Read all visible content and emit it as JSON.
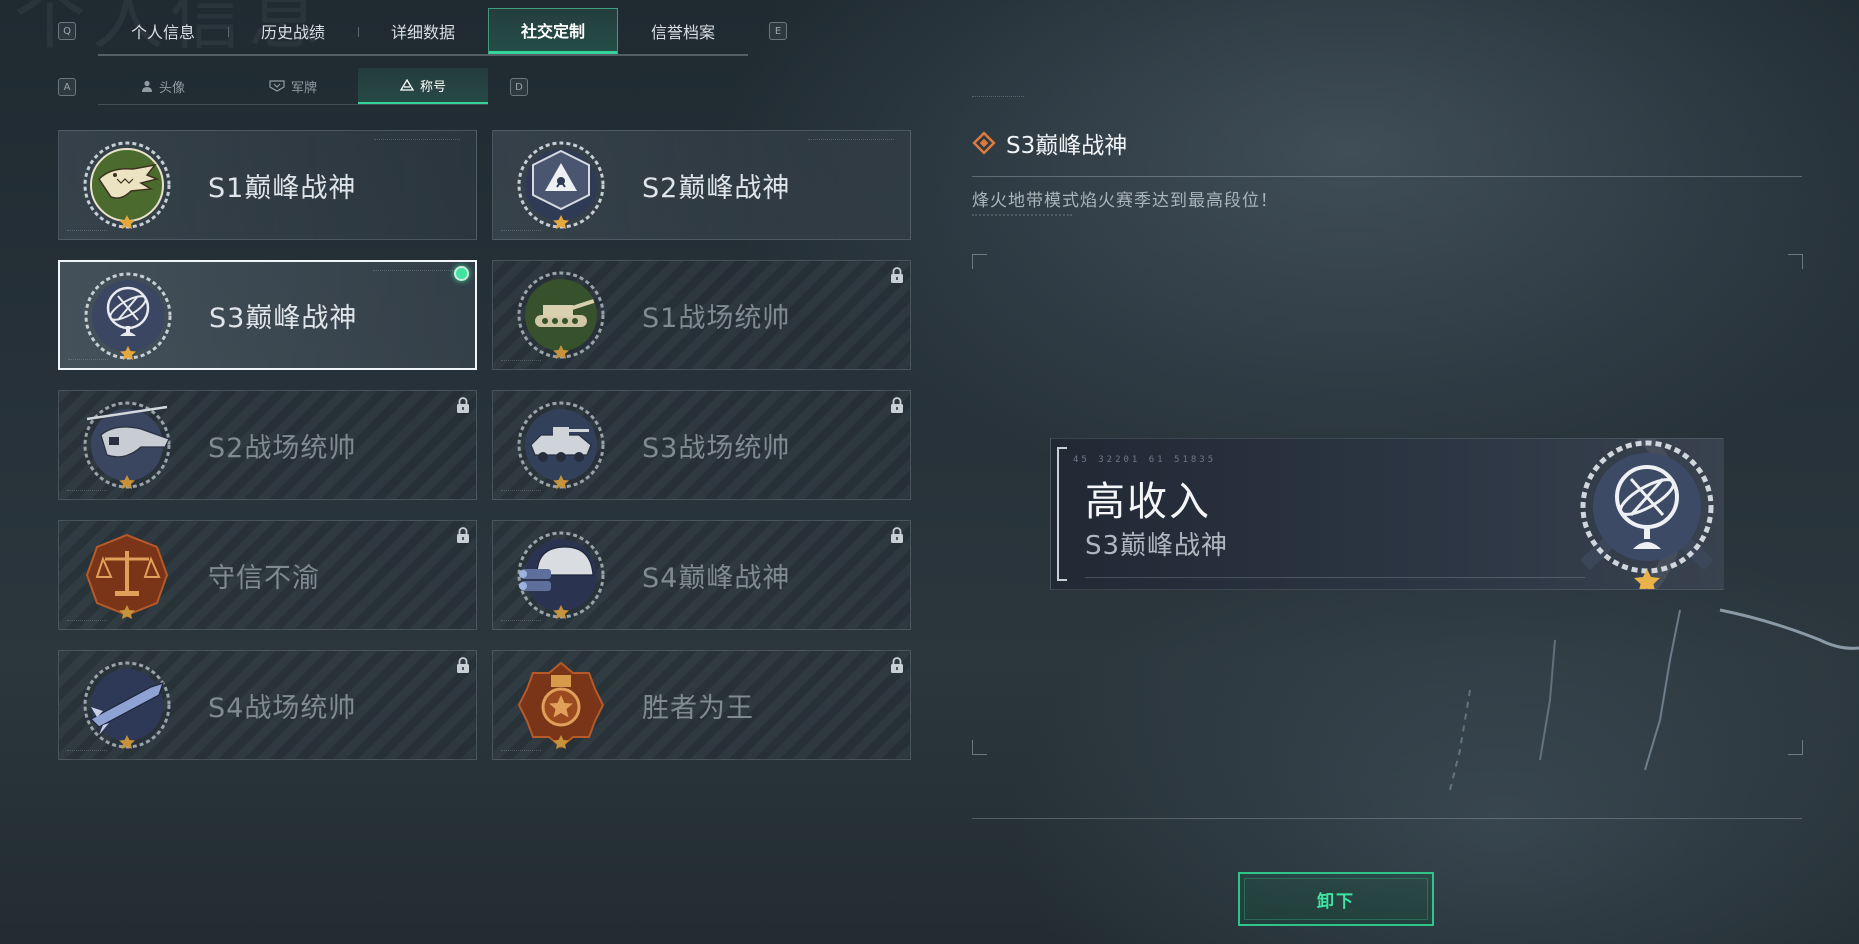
{
  "top_nav": {
    "prev_key": "Q",
    "next_key": "E",
    "tabs": [
      {
        "label": "个人信息"
      },
      {
        "label": "历史战绩"
      },
      {
        "label": "详细数据"
      },
      {
        "label": "社交定制"
      },
      {
        "label": "信誉档案"
      }
    ],
    "active_index": 3
  },
  "sub_nav": {
    "prev_key": "A",
    "next_key": "D",
    "tabs": [
      {
        "label": "头像",
        "icon": "user-icon"
      },
      {
        "label": "军牌",
        "icon": "dog-tag-icon"
      },
      {
        "label": "称号",
        "icon": "title-icon"
      }
    ],
    "active_index": 2
  },
  "titles": [
    {
      "name": "S1巅峰战神",
      "emblem": "crocodile-emblem",
      "locked": false,
      "selected": false
    },
    {
      "name": "S2巅峰战神",
      "emblem": "hazard-triangle-emblem",
      "locked": false,
      "selected": false
    },
    {
      "name": "S3巅峰战神",
      "emblem": "armillary-sphere-emblem",
      "locked": false,
      "selected": true
    },
    {
      "name": "S1战场统帅",
      "emblem": "tank-emblem",
      "locked": true,
      "selected": false
    },
    {
      "name": "S2战场统帅",
      "emblem": "helicopter-emblem",
      "locked": true,
      "selected": false
    },
    {
      "name": "S3战场统帅",
      "emblem": "armored-vehicle-emblem",
      "locked": true,
      "selected": false
    },
    {
      "name": "守信不渝",
      "emblem": "scales-emblem",
      "locked": true,
      "selected": false
    },
    {
      "name": "S4巅峰战神",
      "emblem": "night-vision-helmet-emblem",
      "locked": true,
      "selected": false
    },
    {
      "name": "S4战场统帅",
      "emblem": "missile-emblem",
      "locked": true,
      "selected": false
    },
    {
      "name": "胜者为王",
      "emblem": "star-medal-emblem",
      "locked": true,
      "selected": false
    }
  ],
  "detail": {
    "title": "S3巅峰战神",
    "description": "烽火地带模式焰火赛季达到最高段位！",
    "preview_code": "45 32201  61 51835",
    "preview_main": "高收入",
    "preview_sub": "S3巅峰战神",
    "unequip_label": "卸下"
  },
  "colors": {
    "accent": "#35d39b",
    "title_icon": "#e07a3c"
  }
}
